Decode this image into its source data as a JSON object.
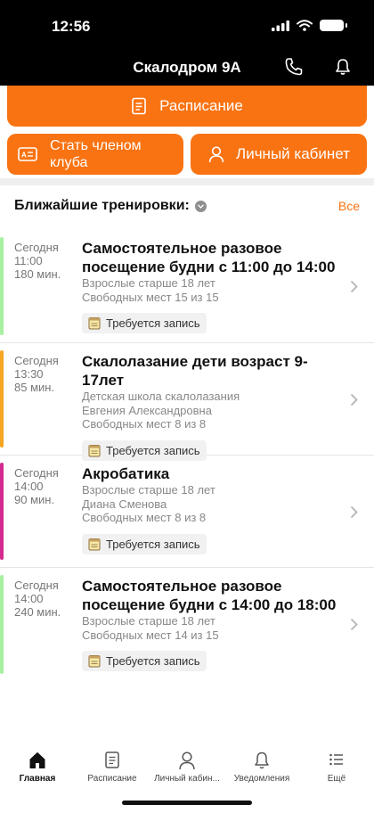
{
  "status_bar": {
    "time": "12:56"
  },
  "header": {
    "title": "Скалодром 9А"
  },
  "actions": {
    "schedule": "Расписание",
    "member_line1": "Стать членом",
    "member_line2": "клуба",
    "cabinet": "Личный кабинет"
  },
  "section": {
    "title": "Ближайшие тренировки:",
    "all_link": "Все"
  },
  "trainings": [
    {
      "day": "Сегодня",
      "time": "11:00",
      "duration": "180 мин.",
      "title": "Самостоятельное разовое посещение будни с 11:00 до 14:00",
      "line1": "Взрослые старше 18 лет",
      "line2": "Свободных мест 15 из 15",
      "line3": "",
      "tag": "Требуется запись",
      "accent": "#a6f0a0"
    },
    {
      "day": "Сегодня",
      "time": "13:30",
      "duration": "85 мин.",
      "title": "Скалолазание дети возраст 9-17лет",
      "line1": "Детская школа скалолазания",
      "line2": "Евгения Александровна",
      "line3": "Свободных мест 8 из 8",
      "tag": "Требуется запись",
      "accent": "#f5a623"
    },
    {
      "day": "Сегодня",
      "time": "14:00",
      "duration": "90 мин.",
      "title": "Акробатика",
      "line1": "Взрослые старше 18 лет",
      "line2": "Диана Сменова",
      "line3": "Свободных мест 8 из 8",
      "tag": "Требуется запись",
      "accent": "#d42a8f"
    },
    {
      "day": "Сегодня",
      "time": "14:00",
      "duration": "240 мин.",
      "title": "Самостоятельное разовое посещение будни с 14:00 до 18:00",
      "line1": "Взрослые старше 18 лет",
      "line2": "Свободных мест 14 из 15",
      "line3": "",
      "tag": "Требуется запись",
      "accent": "#a6f0a0"
    }
  ],
  "tabbar": {
    "home": "Главная",
    "schedule": "Расписание",
    "cabinet": "Личный кабин...",
    "notifications": "Уведомления",
    "more": "Ещё"
  },
  "colors": {
    "accent": "#f97312"
  }
}
